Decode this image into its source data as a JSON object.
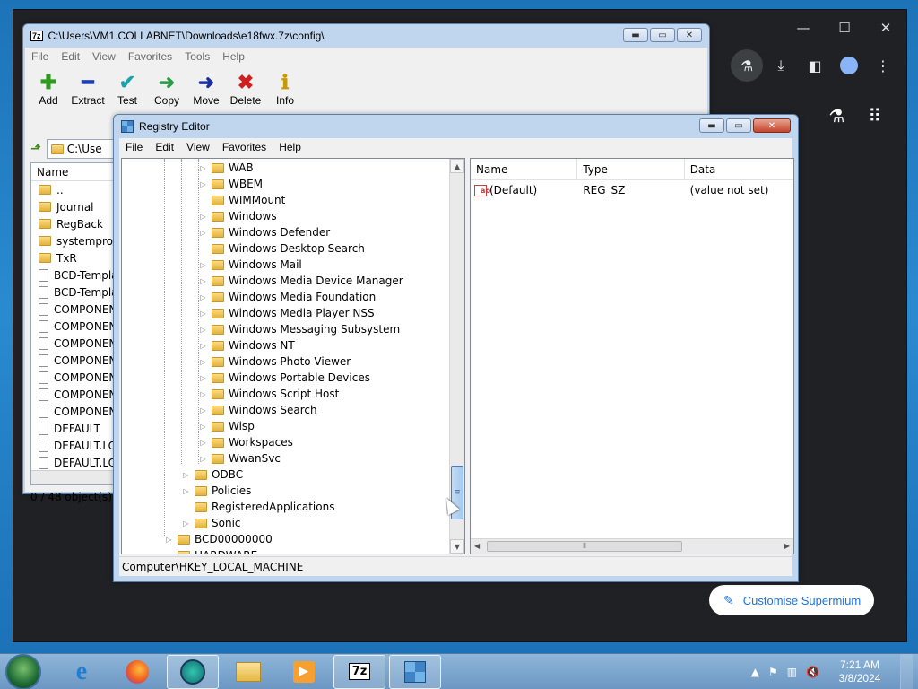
{
  "browser": {
    "controls": [
      "—",
      "☐",
      "✕"
    ],
    "toolbar_icons": [
      "labs-icon",
      "download-icon",
      "sidepanel-icon",
      "profile-icon",
      "menu-icon"
    ],
    "ntp_icons": [
      "labs-icon",
      "apps-grid-icon"
    ],
    "customise_label": "Customise Supermium"
  },
  "sevenzip": {
    "title": "C:\\Users\\VM1.COLLABNET\\Downloads\\e18fwx.7z\\config\\",
    "menu": [
      "File",
      "Edit",
      "View",
      "Favorites",
      "Tools",
      "Help"
    ],
    "tools": [
      {
        "label": "Add",
        "glyph": "✚",
        "color": "#2e9b1f"
      },
      {
        "label": "Extract",
        "glyph": "━",
        "color": "#1c3fb5"
      },
      {
        "label": "Test",
        "glyph": "✔",
        "color": "#1aa3a8"
      },
      {
        "label": "Copy",
        "glyph": "➜",
        "color": "#2b9b4a"
      },
      {
        "label": "Move",
        "glyph": "➜",
        "color": "#1c2fa0"
      },
      {
        "label": "Delete",
        "glyph": "✖",
        "color": "#d11e1e"
      },
      {
        "label": "Info",
        "glyph": "ℹ",
        "color": "#c79a00"
      }
    ],
    "address": "C:\\Use",
    "list_header": "Name",
    "files": [
      {
        "name": "..",
        "type": "folder"
      },
      {
        "name": "Journal",
        "type": "folder"
      },
      {
        "name": "RegBack",
        "type": "folder"
      },
      {
        "name": "systemprofile",
        "type": "folder"
      },
      {
        "name": "TxR",
        "type": "folder"
      },
      {
        "name": "BCD-Templa",
        "type": "file"
      },
      {
        "name": "BCD-Templa",
        "type": "file"
      },
      {
        "name": "COMPONEN",
        "type": "file"
      },
      {
        "name": "COMPONEN",
        "type": "file"
      },
      {
        "name": "COMPONEN",
        "type": "file"
      },
      {
        "name": "COMPONEN",
        "type": "file"
      },
      {
        "name": "COMPONEN",
        "type": "file"
      },
      {
        "name": "COMPONEN",
        "type": "file"
      },
      {
        "name": "COMPONEN",
        "type": "file"
      },
      {
        "name": "DEFAULT",
        "type": "file"
      },
      {
        "name": "DEFAULT.LO",
        "type": "file"
      },
      {
        "name": "DEFAULT.LO",
        "type": "file"
      }
    ],
    "status": "0 / 48 object(s) se"
  },
  "regedit": {
    "title": "Registry Editor",
    "menu": [
      "File",
      "Edit",
      "View",
      "Favorites",
      "Help"
    ],
    "tree": [
      {
        "label": "WAB",
        "depth": 3,
        "expandable": true
      },
      {
        "label": "WBEM",
        "depth": 3,
        "expandable": true
      },
      {
        "label": "WIMMount",
        "depth": 3,
        "expandable": false
      },
      {
        "label": "Windows",
        "depth": 3,
        "expandable": true
      },
      {
        "label": "Windows Defender",
        "depth": 3,
        "expandable": true
      },
      {
        "label": "Windows Desktop Search",
        "depth": 3,
        "expandable": false
      },
      {
        "label": "Windows Mail",
        "depth": 3,
        "expandable": true
      },
      {
        "label": "Windows Media Device Manager",
        "depth": 3,
        "expandable": true
      },
      {
        "label": "Windows Media Foundation",
        "depth": 3,
        "expandable": true
      },
      {
        "label": "Windows Media Player NSS",
        "depth": 3,
        "expandable": true
      },
      {
        "label": "Windows Messaging Subsystem",
        "depth": 3,
        "expandable": true
      },
      {
        "label": "Windows NT",
        "depth": 3,
        "expandable": true
      },
      {
        "label": "Windows Photo Viewer",
        "depth": 3,
        "expandable": true
      },
      {
        "label": "Windows Portable Devices",
        "depth": 3,
        "expandable": true
      },
      {
        "label": "Windows Script Host",
        "depth": 3,
        "expandable": true
      },
      {
        "label": "Windows Search",
        "depth": 3,
        "expandable": true
      },
      {
        "label": "Wisp",
        "depth": 3,
        "expandable": true
      },
      {
        "label": "Workspaces",
        "depth": 3,
        "expandable": true
      },
      {
        "label": "WwanSvc",
        "depth": 3,
        "expandable": true
      },
      {
        "label": "ODBC",
        "depth": 2,
        "expandable": true
      },
      {
        "label": "Policies",
        "depth": 2,
        "expandable": true
      },
      {
        "label": "RegisteredApplications",
        "depth": 2,
        "expandable": false
      },
      {
        "label": "Sonic",
        "depth": 2,
        "expandable": true
      },
      {
        "label": "BCD00000000",
        "depth": 1,
        "expandable": true
      },
      {
        "label": "HARDWARE",
        "depth": 1,
        "expandable": true
      }
    ],
    "columns": [
      "Name",
      "Type",
      "Data"
    ],
    "values": [
      {
        "name": "(Default)",
        "type": "REG_SZ",
        "data": "(value not set)"
      }
    ],
    "status": "Computer\\HKEY_LOCAL_MACHINE"
  },
  "taskbar": {
    "apps": [
      "internet-explorer",
      "firefox",
      "supermium",
      "explorer",
      "media-player",
      "7-zip",
      "registry-editor"
    ],
    "time": "7:21 AM",
    "date": "3/8/2024"
  }
}
